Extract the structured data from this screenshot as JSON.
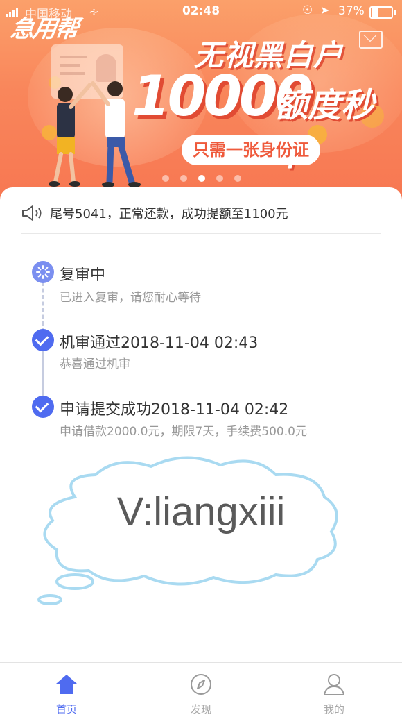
{
  "status_bar": {
    "carrier": "中国移动",
    "time": "02:48",
    "battery": "37%"
  },
  "banner": {
    "logo": "急用帮",
    "headline": "无视黑白户",
    "amount": "10000",
    "amount_suffix": "额度秒下",
    "pill_text": "只需一张身份证",
    "carousel_active_index": 2,
    "carousel_count": 5
  },
  "notice": {
    "text": "尾号5041，正常还款，成功提额至1100元"
  },
  "timeline": [
    {
      "title": "复审中",
      "subtitle": "已进入复审，请您耐心等待",
      "state": "pending"
    },
    {
      "title": "机审通过2018-11-04 02:43",
      "subtitle": "恭喜通过机审",
      "state": "done"
    },
    {
      "title": "申请提交成功2018-11-04 02:42",
      "subtitle": "申请借款2000.0元，期限7天，手续费500.0元",
      "state": "done"
    }
  ],
  "watermark": {
    "text": "V:liangxiii"
  },
  "tabbar": [
    {
      "label": "首页",
      "icon": "home-icon",
      "active": true
    },
    {
      "label": "发现",
      "icon": "compass-icon",
      "active": false
    },
    {
      "label": "我的",
      "icon": "person-icon",
      "active": false
    }
  ],
  "colors": {
    "accent": "#4f6bf0",
    "banner_top": "#fba06a",
    "banner_bottom": "#f77752",
    "pill_text": "#ef5a3c"
  }
}
